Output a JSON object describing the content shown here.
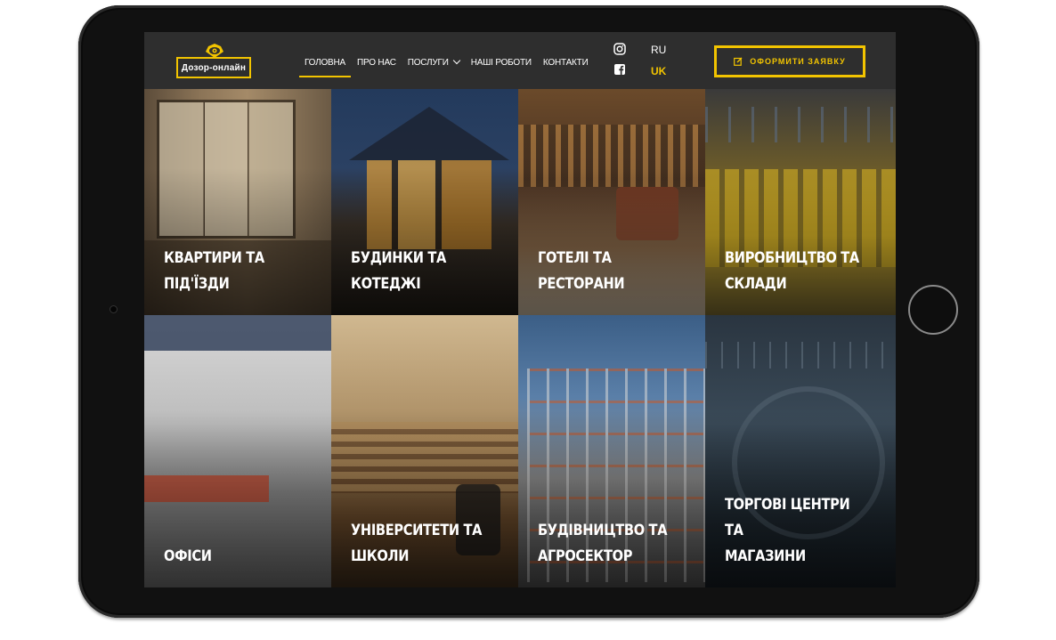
{
  "logo": {
    "text": "Дозор-онлайн"
  },
  "nav": [
    {
      "label": "ГОЛОВНА",
      "active": true,
      "dropdown": false
    },
    {
      "label": "ПРО НАС",
      "active": false,
      "dropdown": false
    },
    {
      "label": "ПОСЛУГИ",
      "active": false,
      "dropdown": true
    },
    {
      "label": "НАШІ РОБОТИ",
      "active": false,
      "dropdown": false
    },
    {
      "label": "КОНТАКТИ",
      "active": false,
      "dropdown": false
    }
  ],
  "social": [
    "instagram-icon",
    "facebook-icon"
  ],
  "languages": {
    "ru": "RU",
    "uk": "UK",
    "selected": "UK"
  },
  "cta": {
    "label": "ОФОРМИТИ ЗАЯВКУ",
    "icon": "edit-icon"
  },
  "tiles": [
    {
      "label": "КВАРТИРИ ТА\nПІД'ЇЗДИ"
    },
    {
      "label": "БУДИНКИ ТА\nКОТЕДЖІ"
    },
    {
      "label": "ГОТЕЛІ ТА\nРЕСТОРАНИ"
    },
    {
      "label": "ВИРОБНИЦТВО ТА\nСКЛАДИ"
    },
    {
      "label": "ОФІСИ"
    },
    {
      "label": "УНІВЕРСИТЕТИ ТА\nШКОЛИ"
    },
    {
      "label": "БУДІВНИЦТВО ТА\nАГРОСЕКТОР"
    },
    {
      "label": "ТОРГОВІ ЦЕНТРИ ТА\nМАГАЗИНИ"
    }
  ],
  "colors": {
    "accent": "#f2c400",
    "header_bg": "#2e2e2e",
    "device": "#111111"
  }
}
